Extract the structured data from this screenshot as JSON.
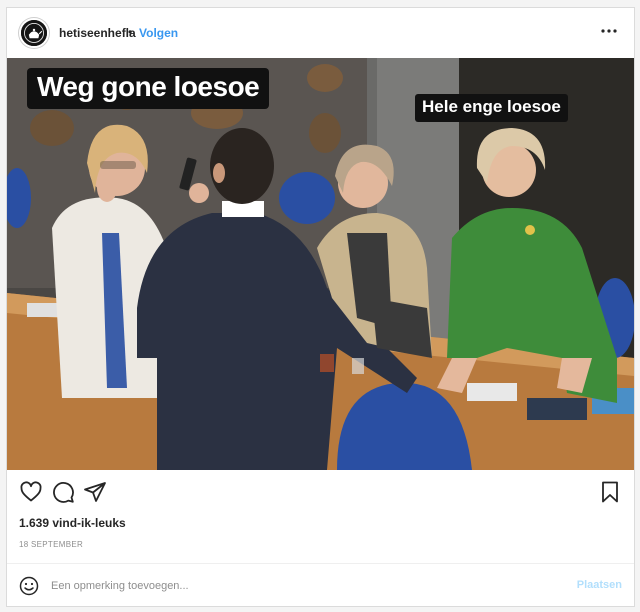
{
  "post": {
    "username": "hetiseenhefla",
    "separator": "•",
    "follow_label": "Volgen",
    "likes_text": "1.639 vind-ik-leuks",
    "date_text": "18 SEPTEMBER"
  },
  "photo": {
    "caption_left": "Weg gone loesoe",
    "caption_right": "Hele enge loesoe"
  },
  "comment": {
    "placeholder": "Een opmerking toevoegen...",
    "post_label": "Plaatsen"
  },
  "icons": {
    "avatar": "teapot-logo-icon",
    "more": "more-options-icon",
    "like": "heart-icon",
    "comment": "comment-bubble-icon",
    "share": "paper-plane-icon",
    "save": "bookmark-icon",
    "emoji": "smiley-icon"
  },
  "colors": {
    "link": "#3897f0",
    "post_disabled": "#b2dffc",
    "muted": "#8e8e8e"
  }
}
